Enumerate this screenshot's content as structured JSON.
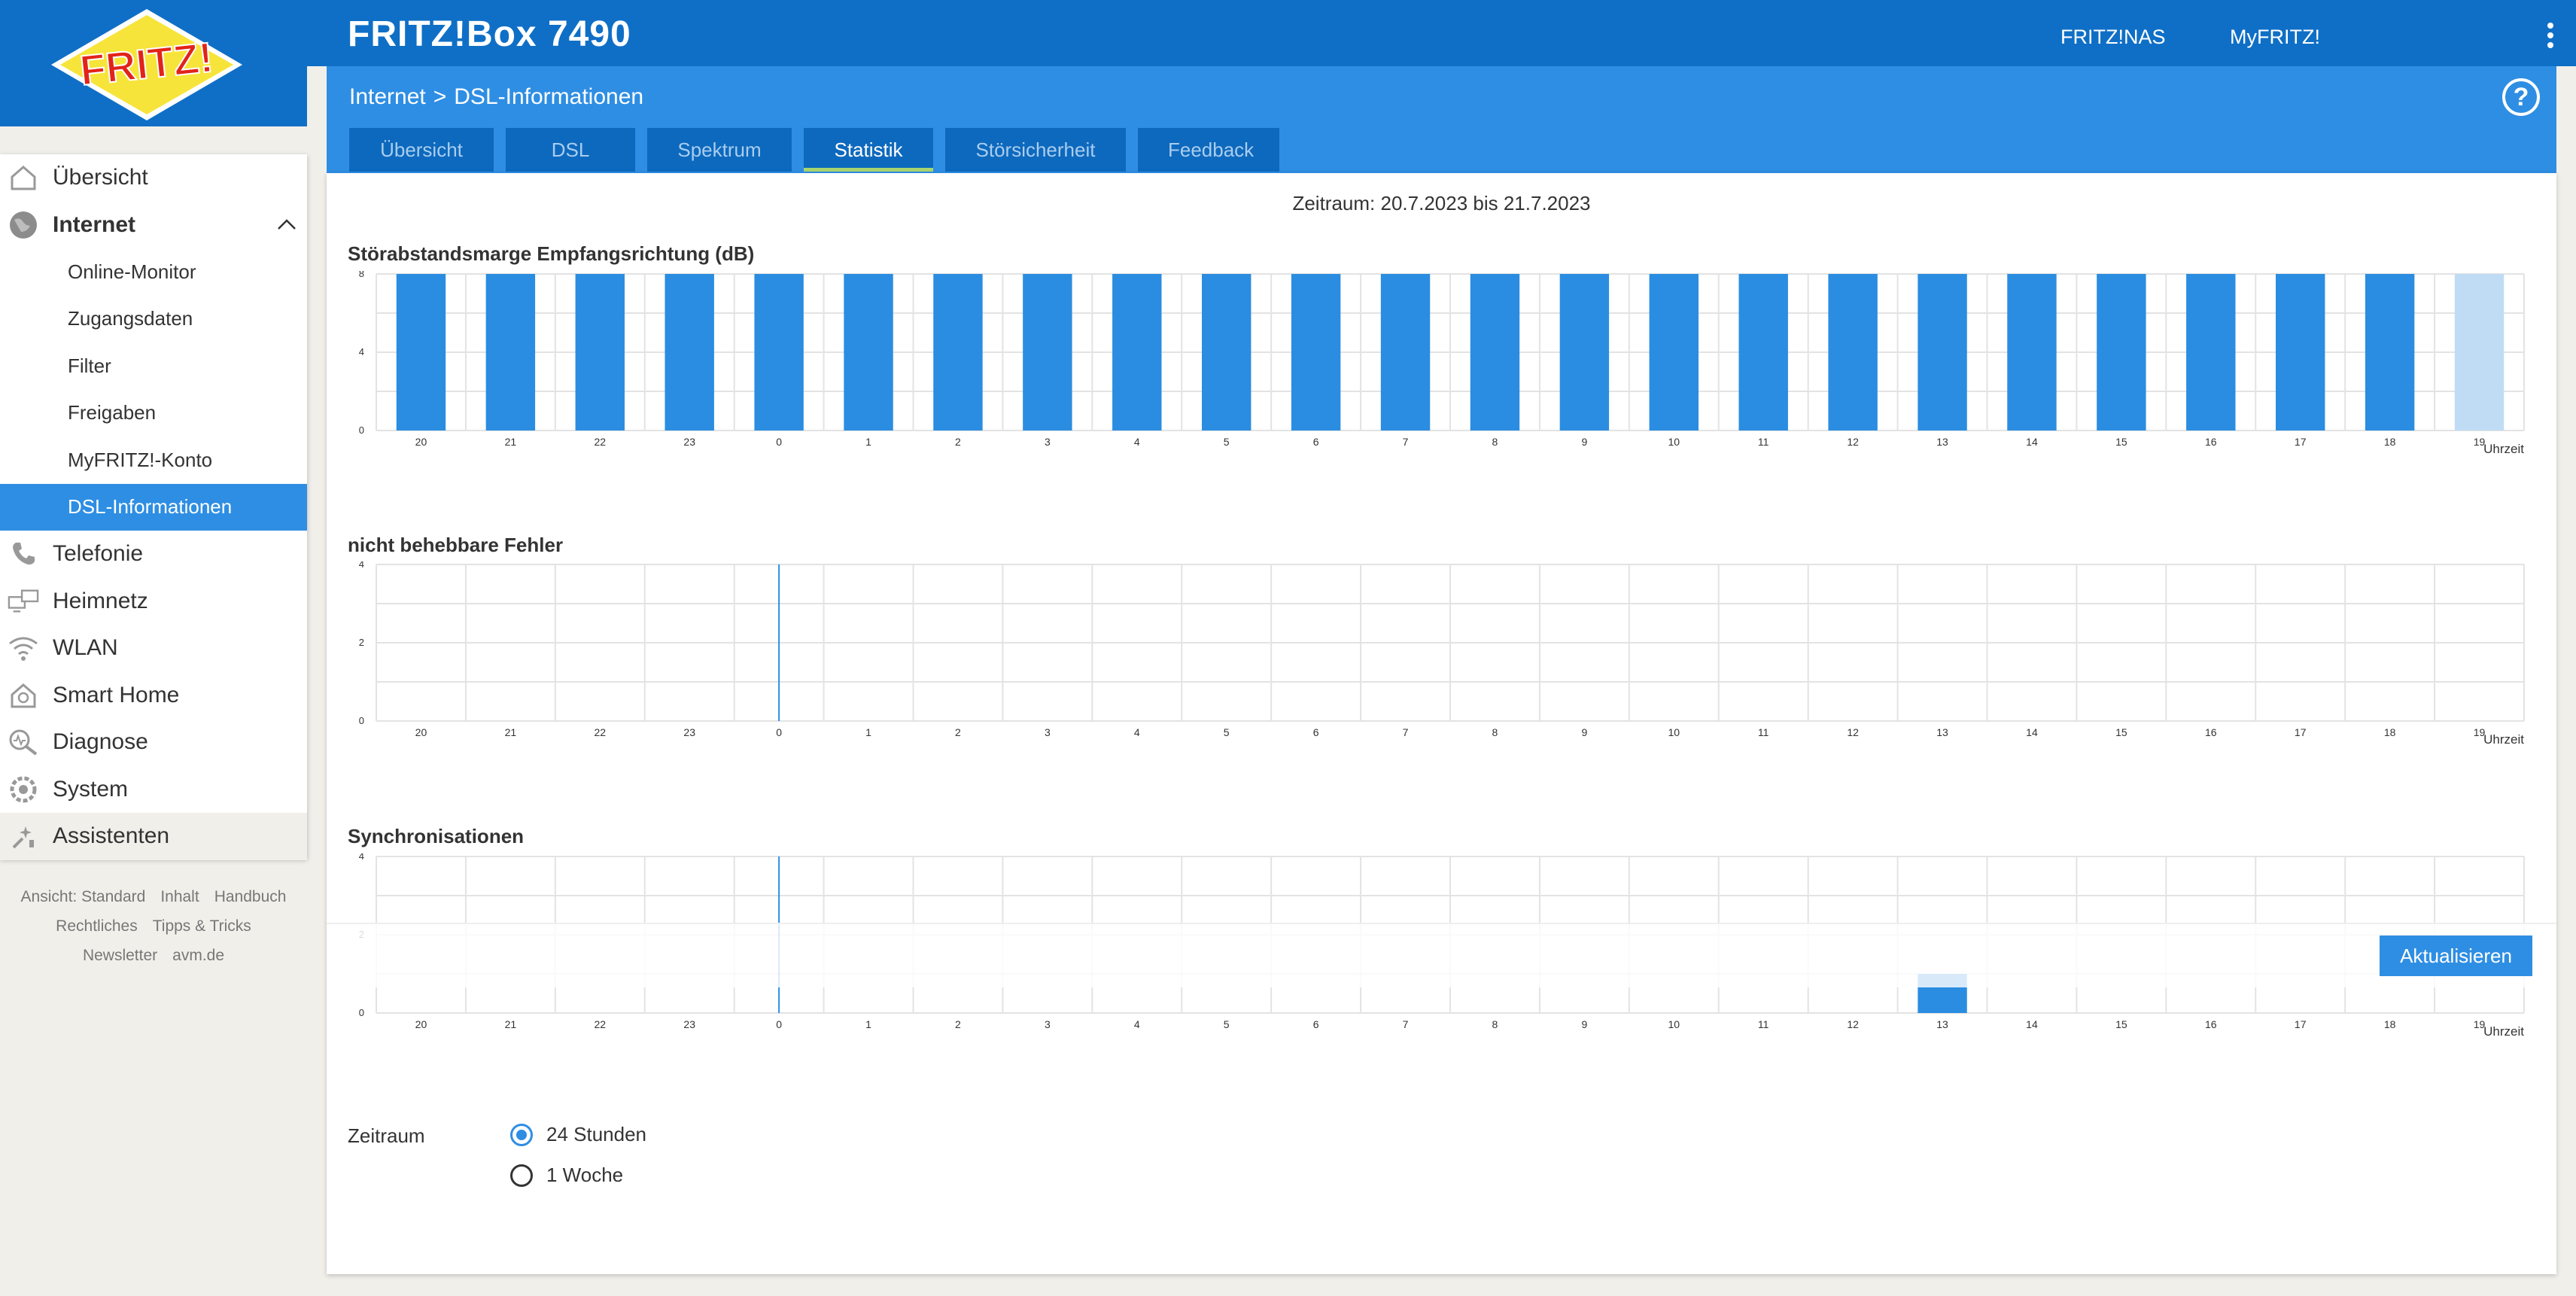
{
  "header": {
    "product": "FRITZ!Box 7490",
    "links": [
      "FRITZ!NAS",
      "MyFRITZ!"
    ],
    "logo_text": "FRITZ!"
  },
  "breadcrumb": {
    "parent": "Internet",
    "separator": ">",
    "current": "DSL-Informationen"
  },
  "tabs": [
    {
      "label": "Übersicht",
      "active": false
    },
    {
      "label": "DSL",
      "active": false
    },
    {
      "label": "Spektrum",
      "active": false
    },
    {
      "label": "Statistik",
      "active": true
    },
    {
      "label": "Störsicherheit",
      "active": false
    },
    {
      "label": "Feedback",
      "active": false
    }
  ],
  "sidebar": {
    "items": [
      {
        "label": "Übersicht",
        "icon": "home-icon"
      },
      {
        "label": "Internet",
        "icon": "globe-icon",
        "expanded": true,
        "children": [
          "Online-Monitor",
          "Zugangsdaten",
          "Filter",
          "Freigaben",
          "MyFRITZ!-Konto",
          "DSL-Informationen"
        ],
        "active_child": "DSL-Informationen"
      },
      {
        "label": "Telefonie",
        "icon": "phone-icon"
      },
      {
        "label": "Heimnetz",
        "icon": "network-icon"
      },
      {
        "label": "WLAN",
        "icon": "wifi-icon"
      },
      {
        "label": "Smart Home",
        "icon": "smart-home-icon"
      },
      {
        "label": "Diagnose",
        "icon": "diagnose-icon"
      },
      {
        "label": "System",
        "icon": "system-icon"
      },
      {
        "label": "Assistenten",
        "icon": "assistant-icon"
      }
    ]
  },
  "footer": {
    "row1": [
      "Ansicht: Standard",
      "Inhalt",
      "Handbuch"
    ],
    "row2": [
      "Rechtliches",
      "Tipps & Tricks"
    ],
    "row3": [
      "Newsletter",
      "avm.de"
    ]
  },
  "content": {
    "period_text": "Zeitraum: 20.7.2023 bis 21.7.2023",
    "refresh_label": "Aktualisieren",
    "zeitraum_label": "Zeitraum",
    "radio_options": [
      {
        "label": "24 Stunden",
        "checked": true
      },
      {
        "label": "1 Woche",
        "checked": false
      }
    ]
  },
  "colors": {
    "primary": "#0f6fc6",
    "accent": "#2e8ee3",
    "bar": "#2a8de1",
    "bar_current": "#bfdcf4",
    "tab_underline": "#a8d46f"
  },
  "chart_data": [
    {
      "type": "bar",
      "title": "Störabstandsmarge Empfangsrichtung (dB)",
      "xlabel": "Uhrzeit",
      "categories": [
        "20",
        "21",
        "22",
        "23",
        "0",
        "1",
        "2",
        "3",
        "4",
        "5",
        "6",
        "7",
        "8",
        "9",
        "10",
        "11",
        "12",
        "13",
        "14",
        "15",
        "16",
        "17",
        "18",
        "19"
      ],
      "values": [
        8,
        8,
        8,
        8,
        8,
        8,
        8,
        8,
        8,
        8,
        8,
        8,
        8,
        8,
        8,
        8,
        8,
        8,
        8,
        8,
        8,
        8,
        8,
        8
      ],
      "current_index": 23,
      "yticks": [
        0,
        4,
        8
      ],
      "ylim": [
        0,
        8
      ]
    },
    {
      "type": "bar",
      "title": "nicht behebbare Fehler",
      "xlabel": "Uhrzeit",
      "categories": [
        "20",
        "21",
        "22",
        "23",
        "0",
        "1",
        "2",
        "3",
        "4",
        "5",
        "6",
        "7",
        "8",
        "9",
        "10",
        "11",
        "12",
        "13",
        "14",
        "15",
        "16",
        "17",
        "18",
        "19"
      ],
      "values": [
        0,
        0,
        0,
        0,
        0,
        0,
        0,
        0,
        0,
        0,
        0,
        0,
        0,
        0,
        0,
        0,
        0,
        0,
        0,
        0,
        0,
        0,
        0,
        0
      ],
      "yticks": [
        0,
        2,
        4
      ],
      "ylim": [
        0,
        4
      ],
      "day_marker_index": 4
    },
    {
      "type": "bar",
      "title": "Synchronisationen",
      "xlabel": "Uhrzeit",
      "categories": [
        "20",
        "21",
        "22",
        "23",
        "0",
        "1",
        "2",
        "3",
        "4",
        "5",
        "6",
        "7",
        "8",
        "9",
        "10",
        "11",
        "12",
        "13",
        "14",
        "15",
        "16",
        "17",
        "18",
        "19"
      ],
      "values": [
        0,
        0,
        0,
        0,
        0,
        0,
        0,
        0,
        0,
        0,
        0,
        0,
        0,
        0,
        0,
        0,
        0,
        1,
        0,
        0,
        0,
        0,
        0,
        0
      ],
      "yticks": [
        0,
        2,
        4
      ],
      "ylim": [
        0,
        4
      ],
      "day_marker_index": 4
    }
  ]
}
